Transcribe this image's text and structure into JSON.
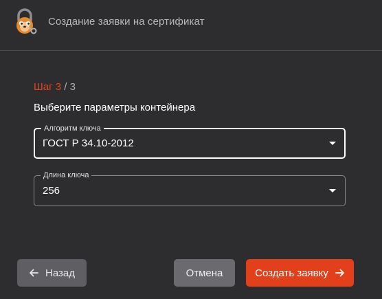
{
  "header": {
    "title": "Создание заявки на сертификат",
    "logo_icon": "lock-mascot-icon"
  },
  "step": {
    "label": "Шаг 3",
    "separator_total": " / 3"
  },
  "subtitle": "Выберите параметры контейнера",
  "fields": {
    "algorithm": {
      "label": "Алгоритм ключа",
      "value": "ГОСТ Р 34.10-2012"
    },
    "key_length": {
      "label": "Длина ключа",
      "value": "256"
    }
  },
  "buttons": {
    "back": "Назад",
    "cancel": "Отмена",
    "create": "Создать заявку"
  },
  "colors": {
    "background": "#2d2d30",
    "accent": "#e2401a",
    "step_current": "#e5431a"
  }
}
